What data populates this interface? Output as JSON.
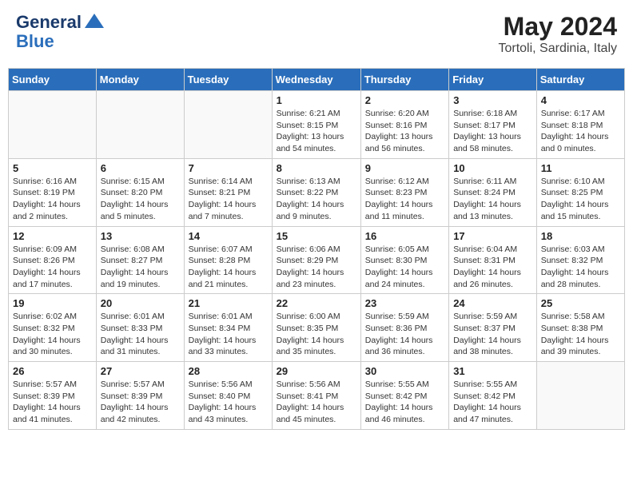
{
  "header": {
    "logo_line1": "General",
    "logo_line2": "Blue",
    "month_title": "May 2024",
    "location": "Tortoli, Sardinia, Italy"
  },
  "days_of_week": [
    "Sunday",
    "Monday",
    "Tuesday",
    "Wednesday",
    "Thursday",
    "Friday",
    "Saturday"
  ],
  "weeks": [
    [
      {
        "day": "",
        "sunrise": "",
        "sunset": "",
        "daylight": ""
      },
      {
        "day": "",
        "sunrise": "",
        "sunset": "",
        "daylight": ""
      },
      {
        "day": "",
        "sunrise": "",
        "sunset": "",
        "daylight": ""
      },
      {
        "day": "1",
        "sunrise": "Sunrise: 6:21 AM",
        "sunset": "Sunset: 8:15 PM",
        "daylight": "Daylight: 13 hours and 54 minutes."
      },
      {
        "day": "2",
        "sunrise": "Sunrise: 6:20 AM",
        "sunset": "Sunset: 8:16 PM",
        "daylight": "Daylight: 13 hours and 56 minutes."
      },
      {
        "day": "3",
        "sunrise": "Sunrise: 6:18 AM",
        "sunset": "Sunset: 8:17 PM",
        "daylight": "Daylight: 13 hours and 58 minutes."
      },
      {
        "day": "4",
        "sunrise": "Sunrise: 6:17 AM",
        "sunset": "Sunset: 8:18 PM",
        "daylight": "Daylight: 14 hours and 0 minutes."
      }
    ],
    [
      {
        "day": "5",
        "sunrise": "Sunrise: 6:16 AM",
        "sunset": "Sunset: 8:19 PM",
        "daylight": "Daylight: 14 hours and 2 minutes."
      },
      {
        "day": "6",
        "sunrise": "Sunrise: 6:15 AM",
        "sunset": "Sunset: 8:20 PM",
        "daylight": "Daylight: 14 hours and 5 minutes."
      },
      {
        "day": "7",
        "sunrise": "Sunrise: 6:14 AM",
        "sunset": "Sunset: 8:21 PM",
        "daylight": "Daylight: 14 hours and 7 minutes."
      },
      {
        "day": "8",
        "sunrise": "Sunrise: 6:13 AM",
        "sunset": "Sunset: 8:22 PM",
        "daylight": "Daylight: 14 hours and 9 minutes."
      },
      {
        "day": "9",
        "sunrise": "Sunrise: 6:12 AM",
        "sunset": "Sunset: 8:23 PM",
        "daylight": "Daylight: 14 hours and 11 minutes."
      },
      {
        "day": "10",
        "sunrise": "Sunrise: 6:11 AM",
        "sunset": "Sunset: 8:24 PM",
        "daylight": "Daylight: 14 hours and 13 minutes."
      },
      {
        "day": "11",
        "sunrise": "Sunrise: 6:10 AM",
        "sunset": "Sunset: 8:25 PM",
        "daylight": "Daylight: 14 hours and 15 minutes."
      }
    ],
    [
      {
        "day": "12",
        "sunrise": "Sunrise: 6:09 AM",
        "sunset": "Sunset: 8:26 PM",
        "daylight": "Daylight: 14 hours and 17 minutes."
      },
      {
        "day": "13",
        "sunrise": "Sunrise: 6:08 AM",
        "sunset": "Sunset: 8:27 PM",
        "daylight": "Daylight: 14 hours and 19 minutes."
      },
      {
        "day": "14",
        "sunrise": "Sunrise: 6:07 AM",
        "sunset": "Sunset: 8:28 PM",
        "daylight": "Daylight: 14 hours and 21 minutes."
      },
      {
        "day": "15",
        "sunrise": "Sunrise: 6:06 AM",
        "sunset": "Sunset: 8:29 PM",
        "daylight": "Daylight: 14 hours and 23 minutes."
      },
      {
        "day": "16",
        "sunrise": "Sunrise: 6:05 AM",
        "sunset": "Sunset: 8:30 PM",
        "daylight": "Daylight: 14 hours and 24 minutes."
      },
      {
        "day": "17",
        "sunrise": "Sunrise: 6:04 AM",
        "sunset": "Sunset: 8:31 PM",
        "daylight": "Daylight: 14 hours and 26 minutes."
      },
      {
        "day": "18",
        "sunrise": "Sunrise: 6:03 AM",
        "sunset": "Sunset: 8:32 PM",
        "daylight": "Daylight: 14 hours and 28 minutes."
      }
    ],
    [
      {
        "day": "19",
        "sunrise": "Sunrise: 6:02 AM",
        "sunset": "Sunset: 8:32 PM",
        "daylight": "Daylight: 14 hours and 30 minutes."
      },
      {
        "day": "20",
        "sunrise": "Sunrise: 6:01 AM",
        "sunset": "Sunset: 8:33 PM",
        "daylight": "Daylight: 14 hours and 31 minutes."
      },
      {
        "day": "21",
        "sunrise": "Sunrise: 6:01 AM",
        "sunset": "Sunset: 8:34 PM",
        "daylight": "Daylight: 14 hours and 33 minutes."
      },
      {
        "day": "22",
        "sunrise": "Sunrise: 6:00 AM",
        "sunset": "Sunset: 8:35 PM",
        "daylight": "Daylight: 14 hours and 35 minutes."
      },
      {
        "day": "23",
        "sunrise": "Sunrise: 5:59 AM",
        "sunset": "Sunset: 8:36 PM",
        "daylight": "Daylight: 14 hours and 36 minutes."
      },
      {
        "day": "24",
        "sunrise": "Sunrise: 5:59 AM",
        "sunset": "Sunset: 8:37 PM",
        "daylight": "Daylight: 14 hours and 38 minutes."
      },
      {
        "day": "25",
        "sunrise": "Sunrise: 5:58 AM",
        "sunset": "Sunset: 8:38 PM",
        "daylight": "Daylight: 14 hours and 39 minutes."
      }
    ],
    [
      {
        "day": "26",
        "sunrise": "Sunrise: 5:57 AM",
        "sunset": "Sunset: 8:39 PM",
        "daylight": "Daylight: 14 hours and 41 minutes."
      },
      {
        "day": "27",
        "sunrise": "Sunrise: 5:57 AM",
        "sunset": "Sunset: 8:39 PM",
        "daylight": "Daylight: 14 hours and 42 minutes."
      },
      {
        "day": "28",
        "sunrise": "Sunrise: 5:56 AM",
        "sunset": "Sunset: 8:40 PM",
        "daylight": "Daylight: 14 hours and 43 minutes."
      },
      {
        "day": "29",
        "sunrise": "Sunrise: 5:56 AM",
        "sunset": "Sunset: 8:41 PM",
        "daylight": "Daylight: 14 hours and 45 minutes."
      },
      {
        "day": "30",
        "sunrise": "Sunrise: 5:55 AM",
        "sunset": "Sunset: 8:42 PM",
        "daylight": "Daylight: 14 hours and 46 minutes."
      },
      {
        "day": "31",
        "sunrise": "Sunrise: 5:55 AM",
        "sunset": "Sunset: 8:42 PM",
        "daylight": "Daylight: 14 hours and 47 minutes."
      },
      {
        "day": "",
        "sunrise": "",
        "sunset": "",
        "daylight": ""
      }
    ]
  ]
}
